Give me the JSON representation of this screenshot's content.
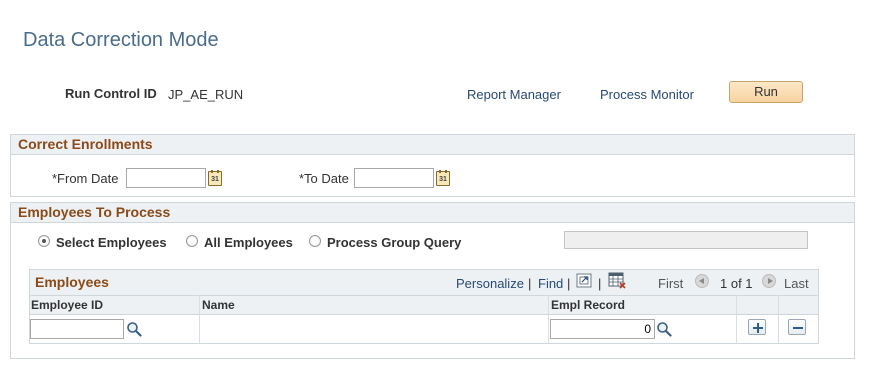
{
  "page": {
    "title": "Data Correction Mode"
  },
  "run_control": {
    "label": "Run Control ID",
    "value": "JP_AE_RUN"
  },
  "links": {
    "report_manager": "Report Manager",
    "process_monitor": "Process Monitor"
  },
  "buttons": {
    "run": "Run"
  },
  "correct_enrollments": {
    "header": "Correct Enrollments",
    "from_date_label": "*From Date",
    "from_date_value": "",
    "to_date_label": "*To Date",
    "to_date_value": "",
    "calendar_glyph": "31"
  },
  "employees_to_process": {
    "header": "Employees To Process",
    "options": [
      "Select Employees",
      "All Employees",
      "Process Group Query"
    ],
    "selected": "Select Employees",
    "query_value": ""
  },
  "employees_grid": {
    "title": "Employees",
    "personalize": "Personalize",
    "find": "Find",
    "separator": "|",
    "first": "First",
    "range": "1 of 1",
    "last": "Last",
    "columns": [
      "Employee ID",
      "Name",
      "Empl Record"
    ],
    "rows": [
      {
        "employee_id": "",
        "name": "",
        "empl_record": "0"
      }
    ]
  },
  "colors": {
    "section_header": "#8b4a18",
    "link": "#274a73",
    "title": "#4a6c8c",
    "run_button": "#f6d3a0"
  },
  "icons": [
    "calendar-icon",
    "search-icon",
    "zoom-icon",
    "download-grid-icon",
    "chevron-left-icon",
    "chevron-right-icon",
    "add-row-icon",
    "delete-row-icon"
  ]
}
